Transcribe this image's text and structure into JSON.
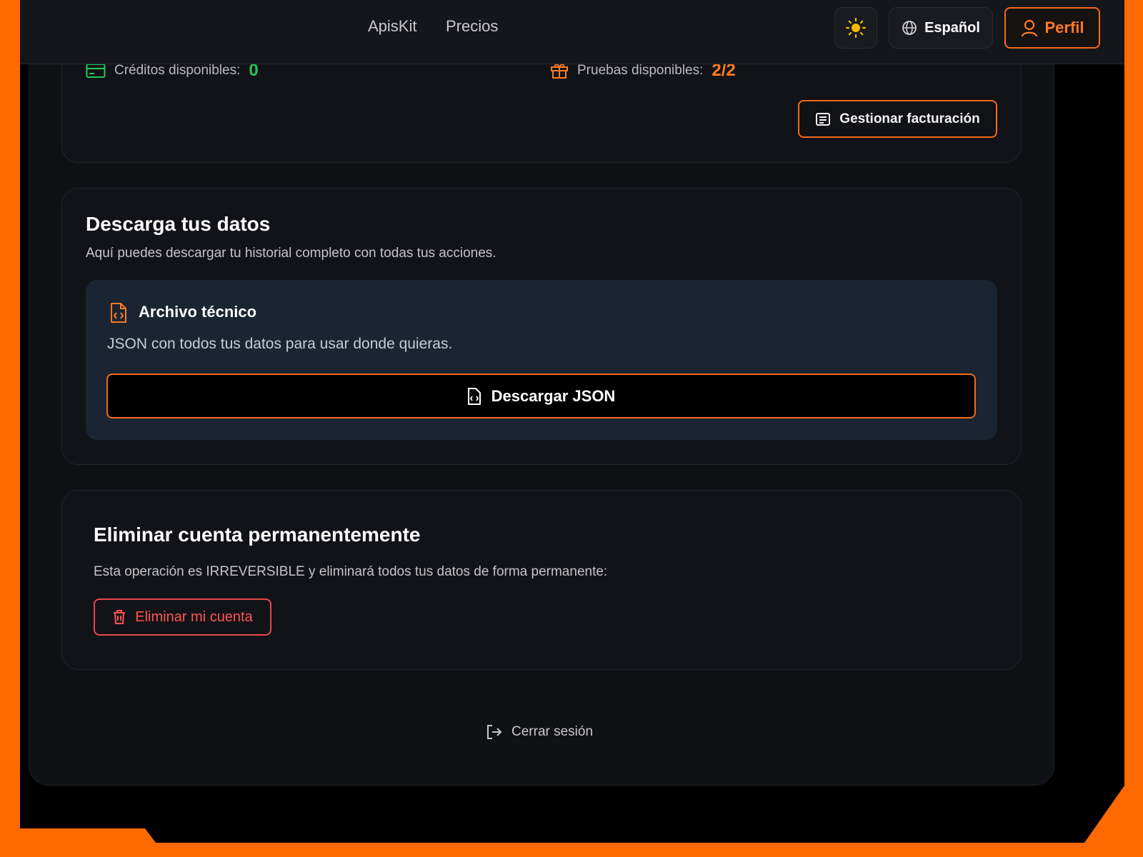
{
  "nav": {
    "links": [
      "ApisKit",
      "Precios"
    ],
    "language": "Español",
    "profile": "Perfil"
  },
  "billing": {
    "credits_label": "Créditos disponibles:",
    "credits_value": "0",
    "trials_label": "Pruebas disponibles:",
    "trials_value": "2/2",
    "manage_button": "Gestionar facturación"
  },
  "download": {
    "title": "Descarga tus datos",
    "subtitle": "Aquí puedes descargar tu historial completo con todas tus acciones.",
    "tech_title": "Archivo técnico",
    "tech_desc": "JSON con todos tus datos para usar donde quieras.",
    "button": "Descargar JSON"
  },
  "delete": {
    "title": "Eliminar cuenta permanentemente",
    "warning": "Esta operación es IRREVERSIBLE y eliminará todos tus datos de forma permanente:",
    "button": "Eliminar mi cuenta"
  },
  "logout": "Cerrar sesión",
  "colors": {
    "accent": "#f26a1b",
    "frame": "#ff6a00",
    "success": "#22c55e",
    "danger": "#ff5454",
    "background": "#101115"
  },
  "icons": {
    "theme": "sun-icon",
    "language": "globe-icon",
    "profile": "user-icon",
    "credits": "credit-card-icon",
    "trials": "gift-icon",
    "billing": "receipt-icon",
    "file": "file-code-icon",
    "delete": "trash-icon",
    "logout": "logout-icon"
  }
}
